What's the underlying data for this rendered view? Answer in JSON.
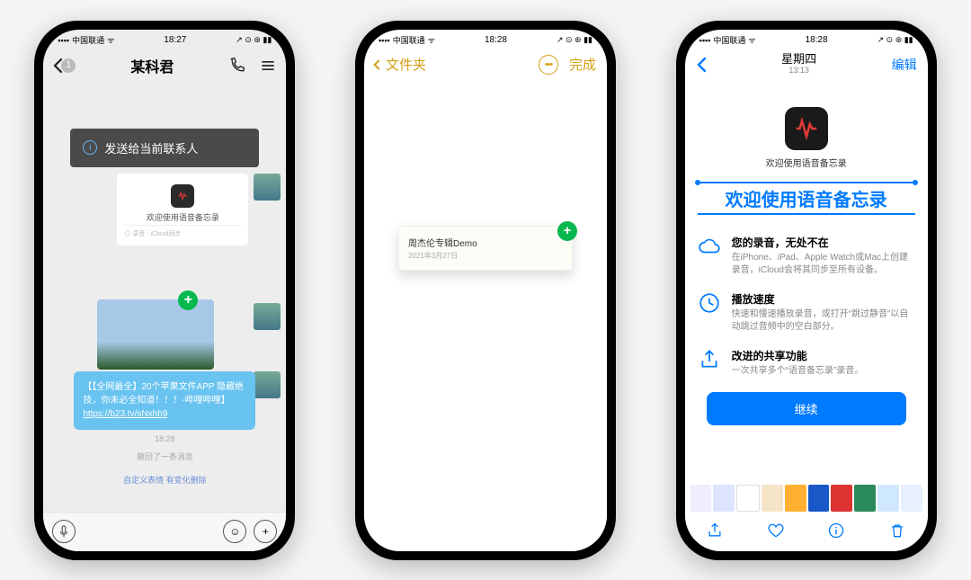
{
  "status": {
    "carrier": "中国联通",
    "t1": "18:27",
    "t2": "18:28",
    "t3": "18:28"
  },
  "p1": {
    "back_badge": "1",
    "title": "某科君",
    "toast": "发送给当前联系人",
    "card_title": "欢迎使用语音备忘录",
    "bubble": "【【全网最全】20个苹果文件APP 隐藏绝技，你未必全知道！！！-哔哩哔哩】",
    "bubble_link": "https://b23.tv/sNxhh9",
    "time": "18:28",
    "sys": "撤回了一条消息",
    "edit_row": "自定义表情   有变化删除"
  },
  "p2": {
    "back": "文件夹",
    "done": "完成",
    "note_title": "周杰伦专辑Demo",
    "note_sub": "2021年3月27日"
  },
  "p3": {
    "day": "星期四",
    "daytime": "13:13",
    "edit": "编辑",
    "caption": "欢迎使用语音备忘录",
    "headline": "欢迎使用语音备忘录",
    "f1t": "您的录音，无处不在",
    "f1d": "在iPhone、iPad、Apple Watch或Mac上创建录音，iCloud会将其同步至所有设备。",
    "f2t": "播放速度",
    "f2d": "快速和慢速播放录音，或打开“跳过静音”以自动跳过音频中的空白部分。",
    "f3t": "改进的共享功能",
    "f3d": "一次共享多个“语音备忘录”录音。",
    "btn": "继续"
  }
}
